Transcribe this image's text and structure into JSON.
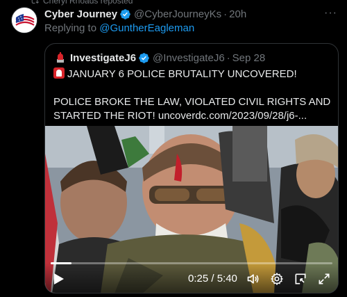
{
  "repost": {
    "text": "Cheryl Rhoads reposted"
  },
  "tweet": {
    "display_name": "Cyber Journey",
    "handle": "@CyberJourneyKs",
    "separator": "·",
    "time": "20h",
    "replying_prefix": "Replying to",
    "replying_to": "@GuntherEagleman",
    "more_label": "···"
  },
  "quote": {
    "display_name": "InvestigateJ6",
    "handle": "@InvestigateJ6",
    "separator": "·",
    "time": "Sep 28",
    "line1": "JANUARY 6 POLICE BRUTALITY UNCOVERED!",
    "line2": "POLICE BROKE THE LAW, VIOLATED CIVIL RIGHTS AND STARTED THE RIOT! uncoverdc.com/2023/09/28/j6-..."
  },
  "video": {
    "time_readout": "0:25 / 5:40",
    "progress_fraction": 0.074
  },
  "colors": {
    "accent": "#1d9bf0",
    "muted": "#71767b",
    "border": "#2f3336"
  },
  "icons": {
    "play": "play-icon",
    "volume": "volume-icon",
    "settings": "gear-icon",
    "pip": "picture-in-picture-icon",
    "fullscreen": "fullscreen-icon",
    "verified": "verified-badge-icon",
    "siren": "siren-emoji-icon"
  }
}
